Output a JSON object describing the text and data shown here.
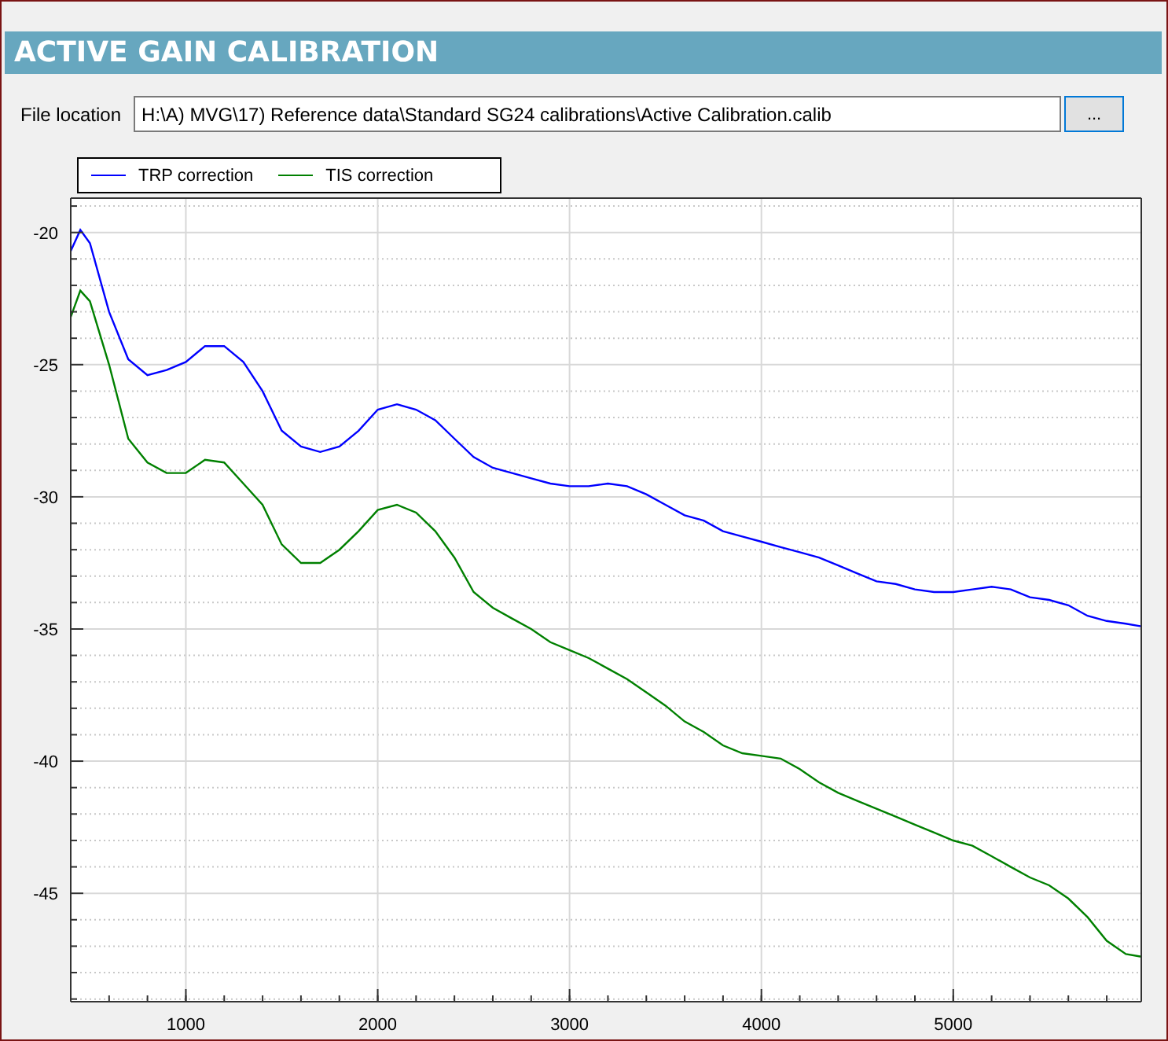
{
  "window": {
    "title": "ACTIVE GAIN CALIBRATION"
  },
  "file_location": {
    "label": "File location",
    "value": "H:\\A) MVG\\17) Reference data\\Standard SG24 calibrations\\Active Calibration.calib",
    "browse_button": "..."
  },
  "chart": {
    "chart_data": {
      "type": "line",
      "x": [
        400,
        450,
        500,
        600,
        700,
        800,
        900,
        1000,
        1100,
        1200,
        1300,
        1400,
        1500,
        1600,
        1700,
        1800,
        1900,
        2000,
        2100,
        2200,
        2300,
        2400,
        2500,
        2600,
        2700,
        2800,
        2900,
        3000,
        3100,
        3200,
        3300,
        3400,
        3500,
        3600,
        3700,
        3800,
        3900,
        4000,
        4100,
        4200,
        4300,
        4400,
        4500,
        4600,
        4700,
        4800,
        4900,
        5000,
        5100,
        5200,
        5300,
        5400,
        5500,
        5600,
        5700,
        5800,
        5900,
        5980
      ],
      "series": [
        {
          "name": "TRP correction",
          "color": "#0000ff",
          "values": [
            -20.7,
            -19.9,
            -20.4,
            -23,
            -24.8,
            -25.4,
            -25.2,
            -24.9,
            -24.3,
            -24.3,
            -24.9,
            -26,
            -27.5,
            -28.1,
            -28.3,
            -28.1,
            -27.5,
            -26.7,
            -26.5,
            -26.7,
            -27.1,
            -27.8,
            -28.5,
            -28.9,
            -29.1,
            -29.3,
            -29.5,
            -29.6,
            -29.6,
            -29.5,
            -29.6,
            -29.9,
            -30.3,
            -30.7,
            -30.9,
            -31.3,
            -31.5,
            -31.7,
            -31.9,
            -32.1,
            -32.3,
            -32.6,
            -32.9,
            -33.2,
            -33.3,
            -33.5,
            -33.6,
            -33.6,
            -33.5,
            -33.4,
            -33.5,
            -33.8,
            -33.9,
            -34.1,
            -34.5,
            -34.7,
            -34.8,
            -34.9
          ]
        },
        {
          "name": "TIS correction",
          "color": "#008000",
          "values": [
            -23.2,
            -22.2,
            -22.6,
            -25,
            -27.8,
            -28.7,
            -29.1,
            -29.1,
            -28.6,
            -28.7,
            -29.5,
            -30.3,
            -31.8,
            -32.5,
            -32.5,
            -32,
            -31.3,
            -30.5,
            -30.3,
            -30.6,
            -31.3,
            -32.3,
            -33.6,
            -34.2,
            -34.6,
            -35,
            -35.5,
            -35.8,
            -36.1,
            -36.5,
            -36.9,
            -37.4,
            -37.9,
            -38.5,
            -38.9,
            -39.4,
            -39.7,
            -39.8,
            -39.9,
            -40.3,
            -40.8,
            -41.2,
            -41.5,
            -41.8,
            -42.1,
            -42.4,
            -42.7,
            -43,
            -43.2,
            -43.6,
            -44,
            -44.4,
            -44.7,
            -45.2,
            -45.9,
            -46.8,
            -47.3,
            -47.4
          ]
        }
      ],
      "xlim": [
        400,
        5980
      ],
      "ylim": [
        -49.1,
        -18.7
      ],
      "xticks": [
        1000,
        2000,
        3000,
        4000,
        5000
      ],
      "yticks": [
        -20,
        -25,
        -30,
        -35,
        -40,
        -45
      ],
      "grid": true
    }
  }
}
